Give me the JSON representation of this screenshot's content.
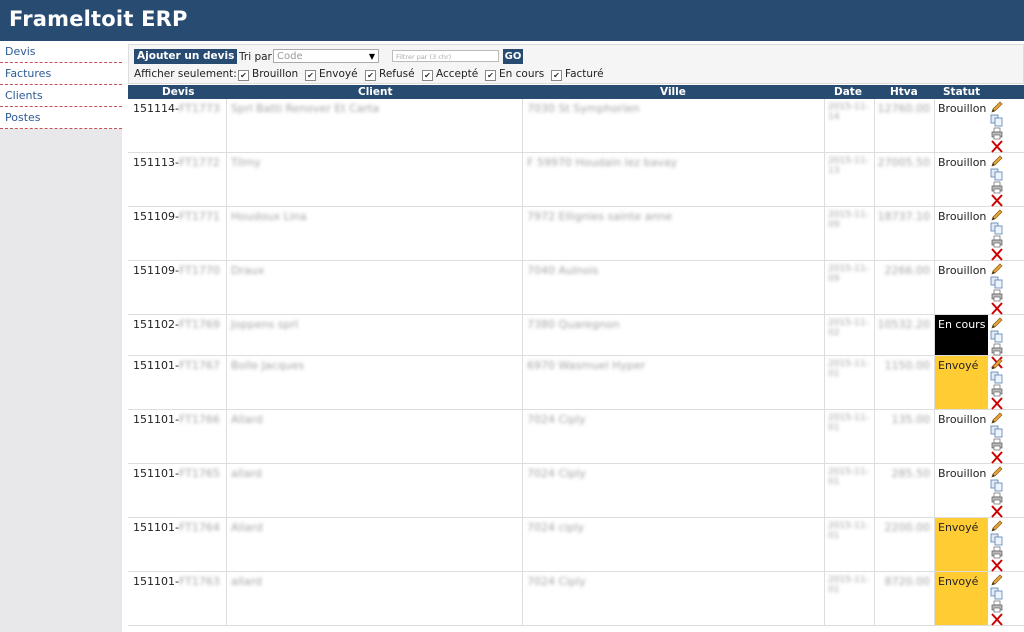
{
  "app": {
    "title": "Frameltoit ERP"
  },
  "sidebar": {
    "items": [
      {
        "label": "Devis"
      },
      {
        "label": "Factures"
      },
      {
        "label": "Clients"
      },
      {
        "label": "Postes"
      }
    ]
  },
  "toolbar": {
    "add_label": "Ajouter un devis",
    "tri_label": "Tri par",
    "tri_value": "Code",
    "filter_placeholder": "Filtrer par (3 chr)",
    "go_label": "GO",
    "afficher_label": "Afficher seulement:",
    "filters": [
      {
        "label": "Brouillon",
        "checked": true
      },
      {
        "label": "Envoyé",
        "checked": true
      },
      {
        "label": "Refusé",
        "checked": true
      },
      {
        "label": "Accepté",
        "checked": true
      },
      {
        "label": "En cours",
        "checked": true
      },
      {
        "label": "Facturé",
        "checked": true
      }
    ]
  },
  "table": {
    "headers": {
      "devis": "Devis",
      "client": "Client",
      "ville": "Ville",
      "date": "Date",
      "htva": "Htva",
      "statut": "Statut"
    },
    "rows": [
      {
        "devis": "151114-",
        "devis_blur": "FT1773",
        "client": "Sprl Batti Renover Et Carta",
        "ville": "7030 St Symphorien",
        "date": "2015-11-14",
        "htva": "12760.00",
        "statut": "Brouillon",
        "statut_type": "brouillon"
      },
      {
        "devis": "151113-",
        "devis_blur": "FT1772",
        "client": "Tilmy",
        "ville": "F 59970 Houdain lez bavay",
        "date": "2015-11-13",
        "htva": "27005.50",
        "statut": "Brouillon",
        "statut_type": "brouillon"
      },
      {
        "devis": "151109-",
        "devis_blur": "FT1771",
        "client": "Houdoux Lina",
        "ville": "7972 Ellignies sainte anne",
        "date": "2015-11-09",
        "htva": "18737.10",
        "statut": "Brouillon",
        "statut_type": "brouillon"
      },
      {
        "devis": "151109-",
        "devis_blur": "FT1770",
        "client": "Draux",
        "ville": "7040 Aulnois",
        "date": "2015-11-09",
        "htva": "2266.00",
        "statut": "Brouillon",
        "statut_type": "brouillon"
      },
      {
        "devis": "151102-",
        "devis_blur": "FT1769",
        "client": "Joppens sprl",
        "ville": "7380 Quaregnon",
        "date": "2015-11-02",
        "htva": "10532.20",
        "statut": "En cours",
        "statut_type": "en-cours"
      },
      {
        "devis": "151101-",
        "devis_blur": "FT1767",
        "client": "Bolle Jacques",
        "ville": "6970 Wasmuel Hyper",
        "date": "2015-11-01",
        "htva": "1150.00",
        "statut": "Envoyé",
        "statut_type": "envoye"
      },
      {
        "devis": "151101-",
        "devis_blur": "FT1766",
        "client": "Allard",
        "ville": "7024 Ciply",
        "date": "2015-11-01",
        "htva": "135.00",
        "statut": "Brouillon",
        "statut_type": "brouillon"
      },
      {
        "devis": "151101-",
        "devis_blur": "FT1765",
        "client": "allard",
        "ville": "7024 Ciply",
        "date": "2015-11-01",
        "htva": "285.50",
        "statut": "Brouillon",
        "statut_type": "brouillon"
      },
      {
        "devis": "151101-",
        "devis_blur": "FT1764",
        "client": "Allard",
        "ville": "7024 ciply",
        "date": "2015-11-01",
        "htva": "2200.00",
        "statut": "Envoyé",
        "statut_type": "envoye"
      },
      {
        "devis": "151101-",
        "devis_blur": "FT1763",
        "client": "allard",
        "ville": "7024 Ciply",
        "date": "2015-11-01",
        "htva": "8720.00",
        "statut": "Envoyé",
        "statut_type": "envoye"
      }
    ]
  },
  "icons": {
    "edit": "pencil-icon",
    "copy": "copy-icon",
    "print": "printer-icon",
    "delete": "delete-x-icon"
  },
  "colors": {
    "header": "#284b72",
    "envoye": "#ffcc33",
    "en_cours": "#000000",
    "delete": "#cc0000"
  }
}
